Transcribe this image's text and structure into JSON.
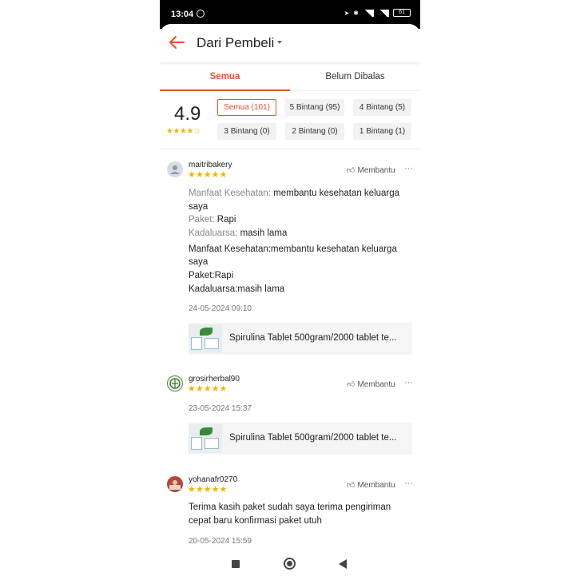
{
  "status_bar": {
    "time": "13:04",
    "battery": "61"
  },
  "header": {
    "title": "Dari Pembeli"
  },
  "tabs": [
    {
      "label": "Semua"
    },
    {
      "label": "Belum Dibalas"
    }
  ],
  "summary": {
    "score": "4.9",
    "stars": "★★★★☆",
    "filters": [
      {
        "label": "Semua (101)"
      },
      {
        "label": "5 Bintang (95)"
      },
      {
        "label": "4 Bintang (5)"
      },
      {
        "label": "3 Bintang (0)"
      },
      {
        "label": "2 Bintang (0)"
      },
      {
        "label": "1 Bintang (1)"
      }
    ]
  },
  "reviews": [
    {
      "username": "maitribakery",
      "stars": "★★★★★",
      "helpful": "Membantu",
      "more": "···",
      "structured": [
        {
          "label": "Manfaat Kesehatan:",
          "value": " membantu kesehatan keluarga"
        },
        {
          "label": "",
          "value": "saya"
        },
        {
          "label": "Paket:",
          "value": " Rapi"
        },
        {
          "label": "Kadaluarsa:",
          "value": " masih lama"
        }
      ],
      "text_lines": [
        "Manfaat Kesehatan:membantu kesehatan keluarga",
        "saya",
        "Paket:Rapi",
        "Kadaluarsa:masih lama"
      ],
      "date": "24-05-2024 09:10",
      "product": "Spirulina Tablet 500gram/2000 tablet te..."
    },
    {
      "username": "grosirherbal90",
      "stars": "★★★★★",
      "helpful": "Membantu",
      "more": "···",
      "date": "23-05-2024 15:37",
      "product": "Spirulina Tablet 500gram/2000 tablet te..."
    },
    {
      "username": "yohanafr0270",
      "stars": "★★★★★",
      "helpful": "Membantu",
      "more": "···",
      "text_lines": [
        "Terima kasih paket sudah saya terima pengiriman",
        "cepat baru konfirmasi paket utuh"
      ],
      "date": "20-05-2024 15:59"
    }
  ],
  "colors": {
    "accent": "#ee4d2d",
    "star": "#f5b400"
  }
}
